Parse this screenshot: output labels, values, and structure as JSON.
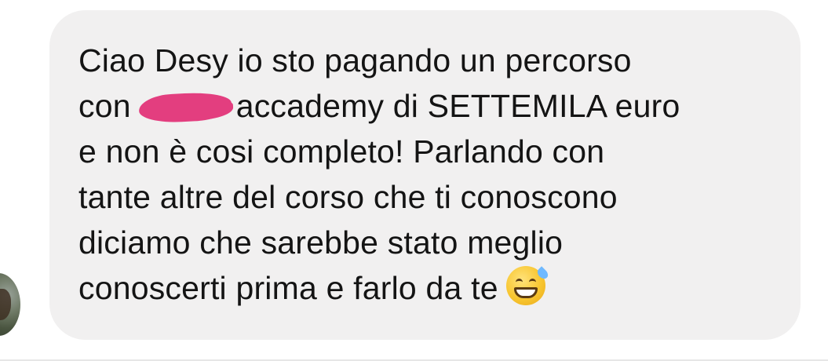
{
  "message": {
    "lines": [
      "Ciao Desy io sto pagando un percorso",
      "con",
      "accademy di SETTEMILA euro",
      "e non è cosi completo! Parlando con",
      "tante altre del corso che ti conoscono",
      "diciamo che sarebbe stato meglio",
      "conoscerti prima e farlo da te"
    ],
    "emoji": "grinning-face-with-sweat",
    "redaction_color": "#e33e7f",
    "bubble_color": "#f1f0f0"
  }
}
